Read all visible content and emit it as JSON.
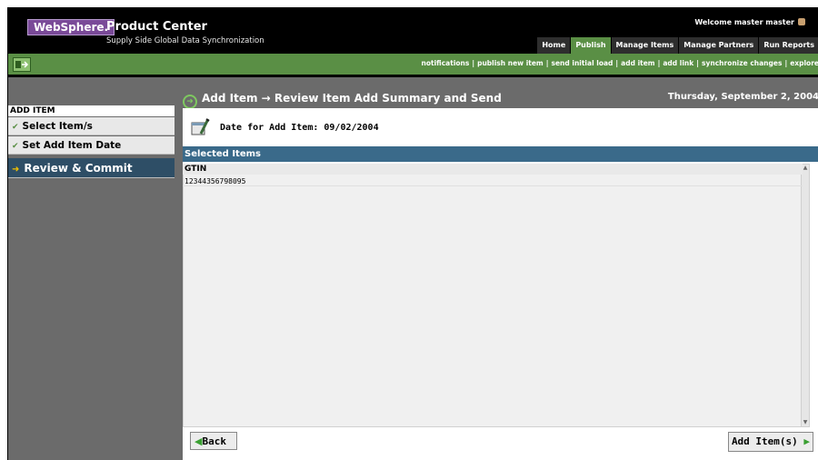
{
  "header": {
    "logo": "WebSphere.",
    "product": "Product Center",
    "subtitle": "Supply Side Global Data Synchronization",
    "welcome": "Welcome  master master"
  },
  "tabs": [
    {
      "label": "Home",
      "active": false
    },
    {
      "label": "Publish",
      "active": true
    },
    {
      "label": "Manage Items",
      "active": false
    },
    {
      "label": "Manage Partners",
      "active": false
    },
    {
      "label": "Run Reports",
      "active": false
    }
  ],
  "links": [
    "notifications",
    "publish new item",
    "send initial load",
    "add item",
    "add link",
    "synchronize changes",
    "explore"
  ],
  "sidebar": {
    "title": "ADD ITEM",
    "steps": [
      {
        "label": "Select Item/s",
        "done": true
      },
      {
        "label": "Set Add Item Date",
        "done": true
      },
      {
        "label": "Review & Commit",
        "active": true
      }
    ]
  },
  "content": {
    "title": "Add Item → Review Item Add Summary and Send",
    "date": "Thursday, September 2, 2004",
    "date_label": "Date for Add Item: 09/02/2004",
    "selected_items_header": "Selected Items",
    "table": {
      "columns": [
        "GTIN"
      ],
      "rows": [
        [
          "12344356798095"
        ]
      ]
    }
  },
  "footer": {
    "back": "Back",
    "add": "Add Item(s)"
  },
  "colors": {
    "accent_green": "#5a8f45",
    "active_step": "#2e4e66",
    "selected_header": "#3a6a8a",
    "logo_purple": "#7a4a98"
  }
}
